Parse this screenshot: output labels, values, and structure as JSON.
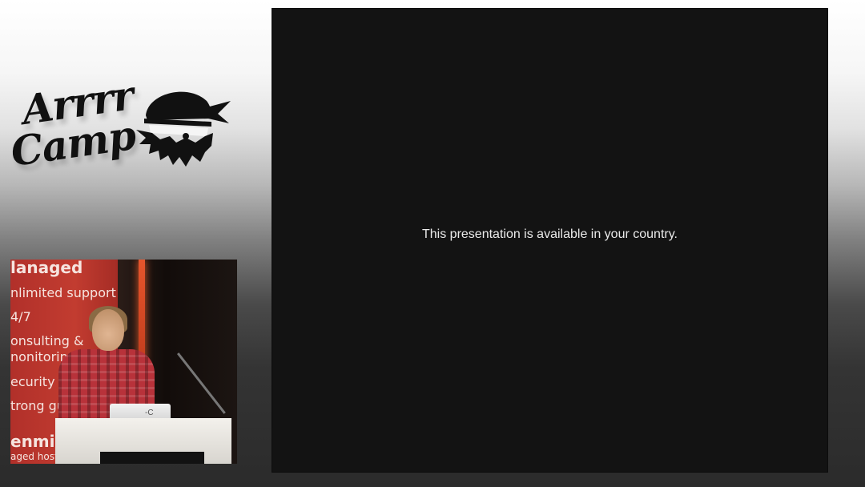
{
  "logo": {
    "line1": "Arrrr",
    "line2": "Camp",
    "icon": "pirate-skull-icon"
  },
  "speaker_video": {
    "banner_heading": "lanaged",
    "banner_lines": [
      "nlimited support",
      "4/7",
      "onsulting &",
      "nonitoring",
      "ecurity",
      "trong gua"
    ],
    "banner_footer": "enmir",
    "banner_footer_small": "aged hostin",
    "laptop_mark": "-C"
  },
  "slide": {
    "message": "This presentation is available in your country."
  },
  "colors": {
    "slide_bg": "#131313",
    "banner_red": "#c23c30",
    "text_light": "#eaeaea"
  }
}
